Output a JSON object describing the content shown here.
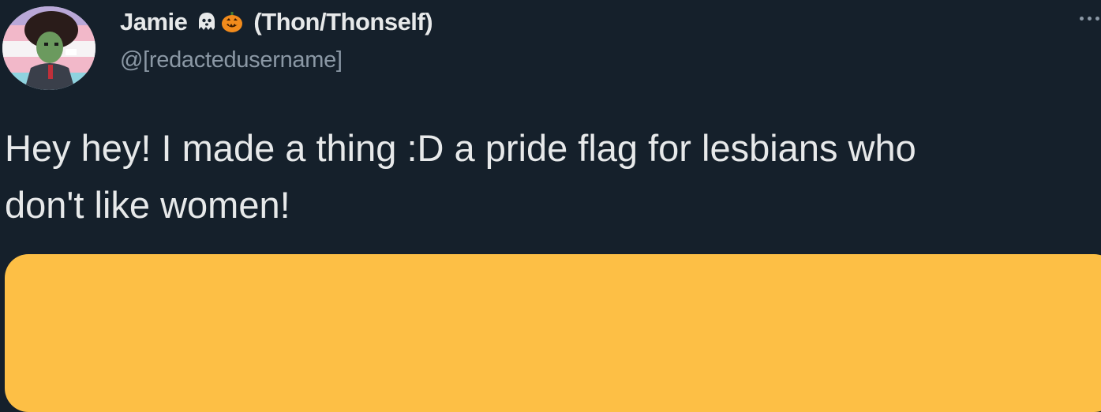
{
  "tweet": {
    "author": {
      "display_name": "Jamie",
      "pronouns": "(Thon/Thonself)",
      "handle": "@[redactedusername]",
      "name_emojis": [
        "ghost-icon",
        "jack-o-lantern-icon"
      ],
      "avatar": "profile-avatar-pixel-art-character"
    },
    "more_options_icon": "more-options-icon",
    "text": "Hey hey! I made a thing :D a pride flag for lesbians who\ndon't like women!",
    "media": {
      "type": "image",
      "color": "#fdbf45"
    }
  },
  "colors": {
    "background": "#15202b",
    "primary_text": "#e7e9ea",
    "secondary_text": "#8b98a5",
    "media_fill": "#fdbf45"
  }
}
